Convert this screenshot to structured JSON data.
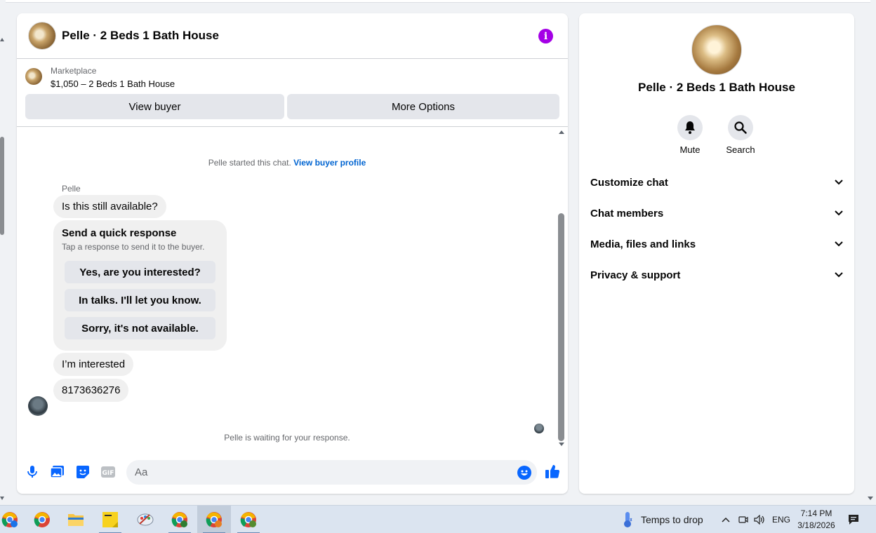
{
  "chat": {
    "title": "Pelle · 2 Beds 1 Bath House",
    "marketplace_label": "Marketplace",
    "listing": "$1,050 – 2 Beds 1 Bath House",
    "view_buyer_label": "View buyer",
    "more_options_label": "More Options",
    "started_text": "Pelle started this chat.",
    "view_profile_link": "View buyer profile",
    "sender_name": "Pelle",
    "messages": [
      {
        "text": "Is this still available?"
      },
      {
        "text": "I’m interested"
      },
      {
        "text": "8173636276"
      }
    ],
    "quick_response": {
      "title": "Send a quick response",
      "subtitle": "Tap a response to send it to the buyer.",
      "options": [
        "Yes, are you interested?",
        "In talks. I'll let you know.",
        "Sorry, it's not available."
      ]
    },
    "waiting_text": "Pelle is waiting for your response.",
    "composer_placeholder": "Aa"
  },
  "info_panel": {
    "title": "Pelle · 2 Beds 1 Bath House",
    "mute_label": "Mute",
    "search_label": "Search",
    "sections": [
      "Customize chat",
      "Chat members",
      "Media, files and links",
      "Privacy & support"
    ]
  },
  "taskbar": {
    "weather_text": "Temps to drop",
    "language": "ENG",
    "time": "7:14 PM",
    "date": "3/18/2026"
  },
  "colors": {
    "accent_blue": "#0866ff",
    "info_purple": "#a400e6",
    "link_blue": "#0064d1"
  }
}
